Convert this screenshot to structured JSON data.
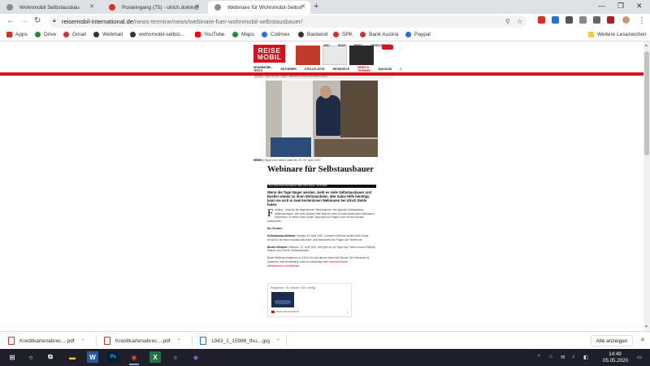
{
  "browser": {
    "tabs": [
      {
        "title": "Wohnmobil Selbstausbau",
        "active": false,
        "favicon_color": "#5f6368"
      },
      {
        "title": "Posteingang (75) - ulrich.dokte@",
        "active": false,
        "favicon_color": "#d93025"
      },
      {
        "title": "Webinare für Wohnmobil-Selbst",
        "active": true,
        "favicon_color": "#5f6368"
      }
    ],
    "new_tab": "+",
    "window_controls": {
      "minimize": "—",
      "restore": "❐",
      "close": "✕"
    },
    "address": {
      "host": "reisemobil-international.de",
      "path": "/news-termine/news/webinare-fuer-wohnmobil-selbstausbauer/"
    },
    "bookmarks": [
      {
        "label": "Apps",
        "color": "#d93025"
      },
      {
        "label": "Drive",
        "color": "#1e8e3e"
      },
      {
        "label": "Gmail",
        "color": "#d93025"
      },
      {
        "label": "Webmail",
        "color": "#333333"
      },
      {
        "label": "wohnmobil-selbst...",
        "color": "#333333"
      },
      {
        "label": "YouTube",
        "color": "#ff0000"
      },
      {
        "label": "Maps",
        "color": "#1e8e3e"
      },
      {
        "label": "Collmex",
        "color": "#1a73e8"
      },
      {
        "label": "Backend",
        "color": "#333333"
      },
      {
        "label": "SPK",
        "color": "#d93025"
      },
      {
        "label": "Bank Austria",
        "color": "#d93025"
      },
      {
        "label": "Paypal",
        "color": "#1a73e8"
      }
    ],
    "other_bookmarks": "Weitere Lesezeichen",
    "icons": {
      "back": "←",
      "forward": "→",
      "reload": "↻",
      "search": "⚲",
      "star": "☆",
      "menu": "⋮"
    }
  },
  "site": {
    "logo_line1": "REISE",
    "logo_line2": "MOBIL",
    "topnav": [
      "ABO",
      "SHOP",
      "PRINT",
      "NEWSLETTER"
    ],
    "nav": [
      "WOHNMOBIL-TESTS",
      "RATGEBER",
      "STELLPLÄTZE",
      "REISEZIELE",
      "NEWS & TERMINE",
      "MAGAZIN"
    ],
    "nav_search": "⚲",
    "breadcrumb": "Startseite > News-Termine > News > Webinare für Wohnmobil-Selbstausbauer"
  },
  "article": {
    "caption_label": "NEWS |",
    "caption_text": "Tipps von Ulrich Dokte am 20. 22. April 2020",
    "title": "Webinare für Selbstausbauer",
    "byline": "Text: Reisemobil International | Bild: Ulrich Dokte · 16.04.2020",
    "lead": "Wenn die Tage länger werden, zieht es viele Selbstausbauer und Bastler wieder zu ihren Wohnmobilen. Wer dabei Hilfe benötigt, kann sie sich in zwei kostenlosen Webinaren bei Ulrich Dokte holen.",
    "dropcap": "F",
    "p1": "rühling – ideal für die angenehmen Temperaturen, den eigenen Selbstausbau weiterzubringen. Wer beim Basteln Hilfe braucht, kann an zwei kostenlosen Webinaren teilnehmen, in denen Ulrich Dokte Tipps gibt und Fragen rund um den Ausbau beantwortet.",
    "h1": "Die Termine:",
    "p2_label": "Selbstausbau-Webinar:",
    "p2": "Montag, 20. April 2020. In diesem Webinar erklärt Ulrich Dokte, worauf es bei einem Ausbau ankommt, und beantwortet die Fragen der Teilnehmer.",
    "p3_label": "Bastler-Webinar:",
    "p3": "Mittwoch, 22. April 2020. Hier geht es um Tipps und Tricks rund um Elektrik, Wasser und Gas für Selbstausbauer.",
    "p4": "Beide Webinare beginnen um 18:00 Uhr und dauern etwa eine Stunde. Die Teilnahme ist kostenlos, eine Anmeldung vorab ist notwendig unter",
    "p4_link": "www.wohnmobil-selbstausbau.com/webinare",
    "card_header": "Ratgeber: So heizen Sie richtig",
    "card_source": "Reisemobil International",
    "card_share": "<"
  },
  "downloads": [
    {
      "name": "Kreditkartenabrec....pdf",
      "type": "pdf"
    },
    {
      "name": "Kreditkartenabrec....pdf",
      "type": "pdf"
    },
    {
      "name": "1943_1_15986_thu....jpg",
      "type": "jpg"
    }
  ],
  "downloads_show_all": "Alle anzeigen",
  "downloads_close": "✕",
  "taskbar": {
    "time": "14:49",
    "date": "05.05.2020",
    "apps": [
      {
        "name": "start",
        "glyph": "⊞",
        "color": "#ffffff"
      },
      {
        "name": "search",
        "glyph": "○",
        "color": "#ffffff"
      },
      {
        "name": "task-view",
        "glyph": "⧉",
        "color": "#ffffff"
      },
      {
        "name": "file-explorer",
        "glyph": "▬",
        "color": "#f0c04a"
      },
      {
        "name": "word",
        "glyph": "W",
        "color": "#2b579a"
      },
      {
        "name": "photoshop",
        "glyph": "Ps",
        "color": "#31a8ff"
      },
      {
        "name": "chrome",
        "glyph": "◉",
        "color": "#ea4335"
      },
      {
        "name": "excel",
        "glyph": "X",
        "color": "#217346"
      },
      {
        "name": "edge",
        "glyph": "e",
        "color": "#3277bc"
      },
      {
        "name": "other",
        "glyph": "◆",
        "color": "#8a5cd1"
      }
    ],
    "tray": [
      "^",
      "⌂",
      "✉",
      "♪",
      "◧"
    ]
  },
  "colors": {
    "brand_red": "#d5101f",
    "tab_bg": "#dee1e6",
    "taskbar": "#1f1f2a"
  }
}
